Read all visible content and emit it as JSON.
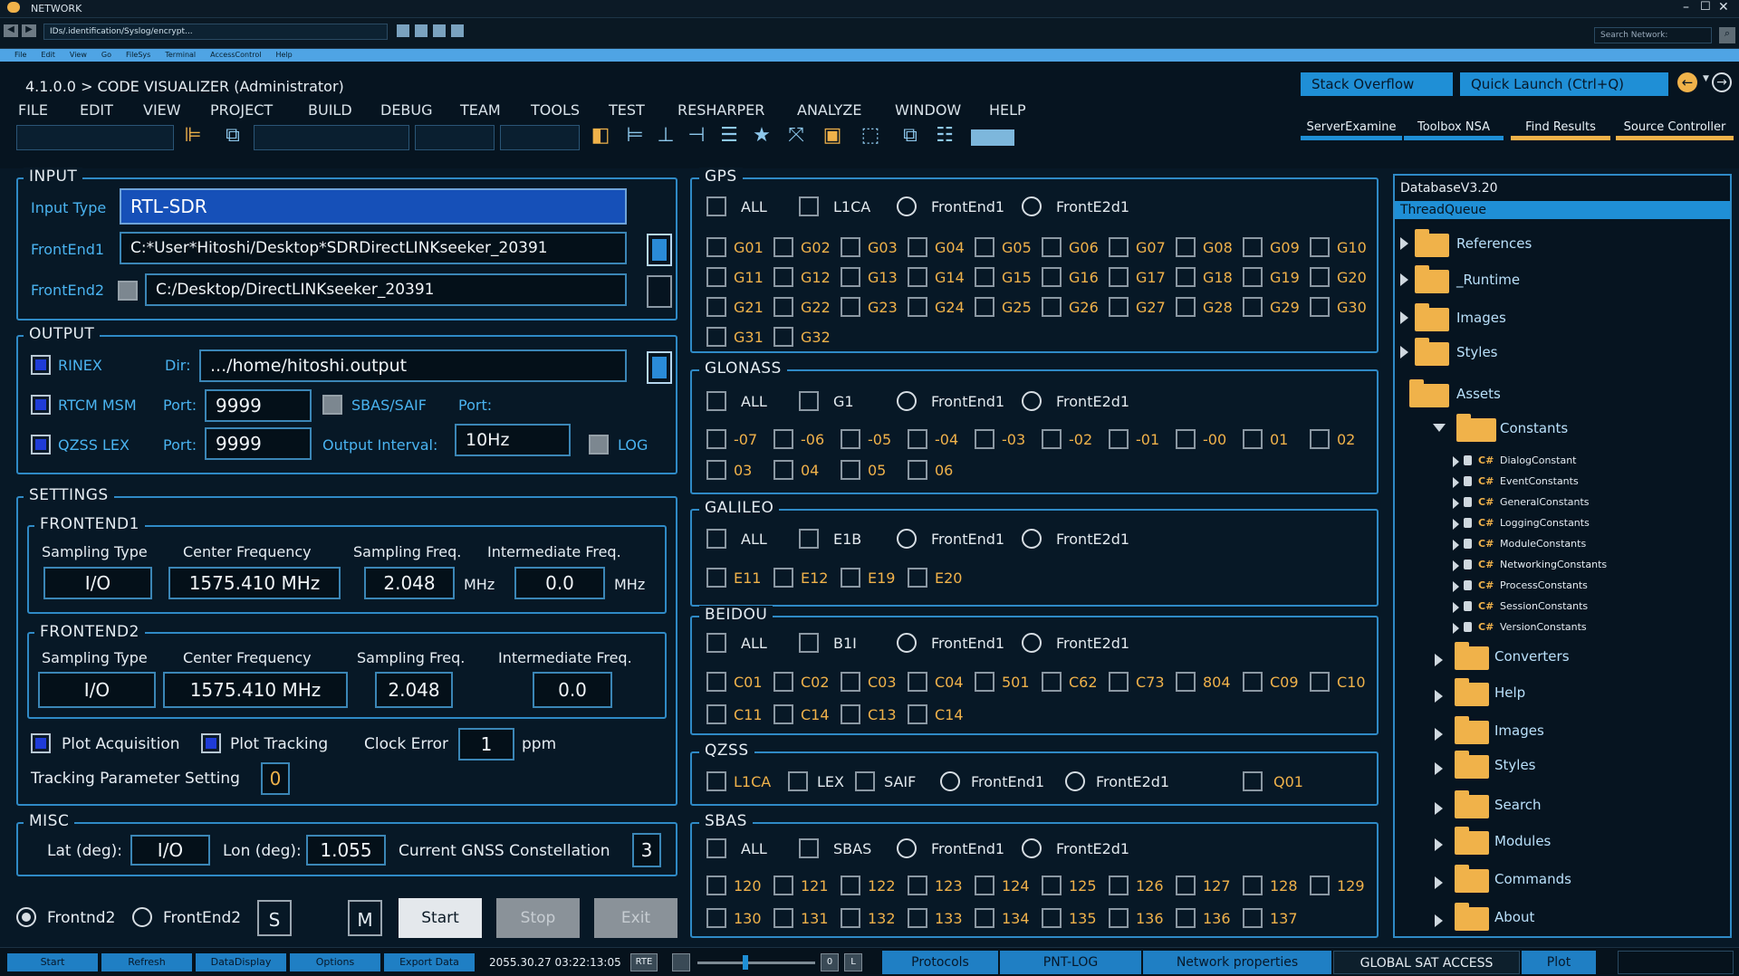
{
  "window": {
    "title": "NETWORK",
    "url": "IDs/.identification/Syslog/encrypt...",
    "search_placeholder": "Search Network:",
    "menu": [
      "File",
      "Edit",
      "View",
      "Go",
      "FileSys",
      "Terminal",
      "AccessControl",
      "Help"
    ]
  },
  "app": {
    "title": "4.1.0.0 > CODE VISUALIZER  (Administrator)",
    "menu": [
      "FILE",
      "EDIT",
      "VIEW",
      "PROJECT",
      "BUILD",
      "DEBUG",
      "TEAM",
      "TOOLS",
      "TEST",
      "RESHARPER",
      "ANALYZE",
      "WINDOW",
      "HELP"
    ],
    "stack_overflow": "Stack Overflow",
    "quick_launch": "Quick Launch (Ctrl+Q)",
    "tabs": [
      {
        "label": "ServerExamine",
        "color": "#1f8fd6"
      },
      {
        "label": "Toolbox NSA",
        "color": "#1f8fd6"
      },
      {
        "label": "Find Results",
        "color": "#f0b24a"
      },
      {
        "label": "Source Controller",
        "color": "#f0b24a"
      }
    ]
  },
  "input": {
    "legend": "INPUT",
    "type_label": "Input Type",
    "type_value": "RTL-SDR",
    "fe1_label": "FrontEnd1",
    "fe1_value": "C:*User*Hitoshi/Desktop*SDRDirectLINKseeker_20391",
    "fe2_label": "FrontEnd2",
    "fe2_value": "C:/Desktop/DirectLINKseeker_20391"
  },
  "output": {
    "legend": "OUTPUT",
    "rinex": "RINEX",
    "dir_label": "Dir:",
    "dir_value": ".../home/hitoshi.output",
    "rtcm": "RTCM MSM",
    "port_label": "Port:",
    "port1": "9999",
    "sbas": "SBAS/SAIF",
    "port2_label": "Port:",
    "qzss": "QZSS LEX",
    "port3_label": "Port:",
    "port3": "9999",
    "interval_label": "Output Interval:",
    "interval": "10Hz",
    "log": "LOG"
  },
  "settings": {
    "legend": "SETTINGS",
    "fe1": {
      "legend": "FRONTEND1",
      "h_type": "Sampling Type",
      "h_center": "Center Frequency",
      "h_samp": "Sampling Freq.",
      "h_inter": "Intermediate Freq.",
      "type": "I/O",
      "center": "1575.410 MHz",
      "samp": "2.048",
      "unit1": "MHz",
      "inter": "0.0",
      "unit2": "MHz"
    },
    "fe2": {
      "legend": "FRONTEND2",
      "h_type": "Sampling Type",
      "h_center": "Center Frequency",
      "h_samp": "Sampling Freq.",
      "h_inter": "Intermediate Freq.",
      "type": "I/O",
      "center": "1575.410 MHz",
      "samp": "2.048",
      "inter": "0.0"
    },
    "plot_acq": "Plot Acquisition",
    "plot_track": "Plot Tracking",
    "clock_label": "Clock Error",
    "clock_value": "1",
    "clock_unit": "ppm",
    "tracking_label": "Tracking Parameter Setting",
    "tracking_value": "0"
  },
  "misc": {
    "legend": "MISC",
    "lat_label": "Lat (deg):",
    "lat_value": "I/O",
    "lon_label": "Lon (deg):",
    "lon_value": "1.055",
    "gnss_label": "Current GNSS Constellation",
    "gnss_value": "3"
  },
  "bottom": {
    "radio1": "Frontnd2",
    "radio2": "FrontEnd2",
    "s": "S",
    "m": "M",
    "start": "Start",
    "stop": "Stop",
    "exit": "Exit"
  },
  "gps": {
    "legend": "GPS",
    "all": "ALL",
    "l1ca": "L1CA",
    "fe1": "FrontEnd1",
    "fe2": "FrontE2d1",
    "sats": [
      "G01",
      "G02",
      "G03",
      "G04",
      "G05",
      "G06",
      "G07",
      "G08",
      "G09",
      "G10",
      "G11",
      "G12",
      "G13",
      "G14",
      "G15",
      "G16",
      "G17",
      "G18",
      "G19",
      "G20",
      "G21",
      "G22",
      "G23",
      "G24",
      "G25",
      "G26",
      "G27",
      "G28",
      "G29",
      "G30",
      "G31",
      "G32"
    ]
  },
  "glonass": {
    "legend": "GLONASS",
    "all": "ALL",
    "g1": "G1",
    "fe1": "FrontEnd1",
    "fe2": "FrontE2d1",
    "sats": [
      "-07",
      "-06",
      "-05",
      "-04",
      "-03",
      "-02",
      "-01",
      "-00",
      "01",
      "02",
      "03",
      "04",
      "05",
      "06"
    ]
  },
  "galileo": {
    "legend": "GALILEO",
    "all": "ALL",
    "e1b": "E1B",
    "fe1": "FrontEnd1",
    "fe2": "FrontE2d1",
    "sats": [
      "E11",
      "E12",
      "E19",
      "E20"
    ]
  },
  "beidou": {
    "legend": "BEIDOU",
    "all": "ALL",
    "b1i": "B1I",
    "fe1": "FrontEnd1",
    "fe2": "FrontE2d1",
    "sats": [
      "C01",
      "C02",
      "C03",
      "C04",
      "501",
      "C62",
      "C73",
      "804",
      "C09",
      "C10",
      "C11",
      "C14",
      "C13",
      "C14"
    ]
  },
  "qzss": {
    "legend": "QZSS",
    "l1ca": "L1CA",
    "lex": "LEX",
    "saif": "SAIF",
    "fe1": "FrontEnd1",
    "fe2": "FrontE2d1",
    "q01": "Q01"
  },
  "sbas": {
    "legend": "SBAS",
    "all": "ALL",
    "sbas": "SBAS",
    "fe1": "FrontEnd1",
    "fe2": "FrontE2d1",
    "sats": [
      "120",
      "121",
      "122",
      "123",
      "124",
      "125",
      "126",
      "127",
      "128",
      "129",
      "130",
      "131",
      "132",
      "133",
      "134",
      "135",
      "136",
      "136",
      "137"
    ]
  },
  "tree": {
    "title": "DatabaseV3.20",
    "selected": "ThreadQueue",
    "top": [
      "References",
      "_Runtime",
      "Images",
      "Styles"
    ],
    "assets": "Assets",
    "constants": "Constants",
    "classes": [
      "DialogConstant",
      "EventConstants",
      "GeneralConstants",
      "LoggingConstants",
      "ModuleConstants",
      "NetworkingConstants",
      "ProcessConstants",
      "SessionConstants",
      "VersionConstants"
    ],
    "bottom": [
      "Converters",
      "Help",
      "Images",
      "Styles",
      "Search",
      "Modules",
      "Commands",
      "About"
    ],
    "cs": "C#"
  },
  "status": {
    "buttons": [
      "Start",
      "Refresh",
      "DataDisplay",
      "Options",
      "Export Data"
    ],
    "timestamp": "2055.30.27 03:22:13:05",
    "rte": "RTE",
    "zero": "0",
    "l": "L",
    "tabs": [
      "Protocols",
      "PNT-LOG",
      "Network properties",
      "GLOBAL SAT ACCESS",
      "Plot"
    ]
  }
}
